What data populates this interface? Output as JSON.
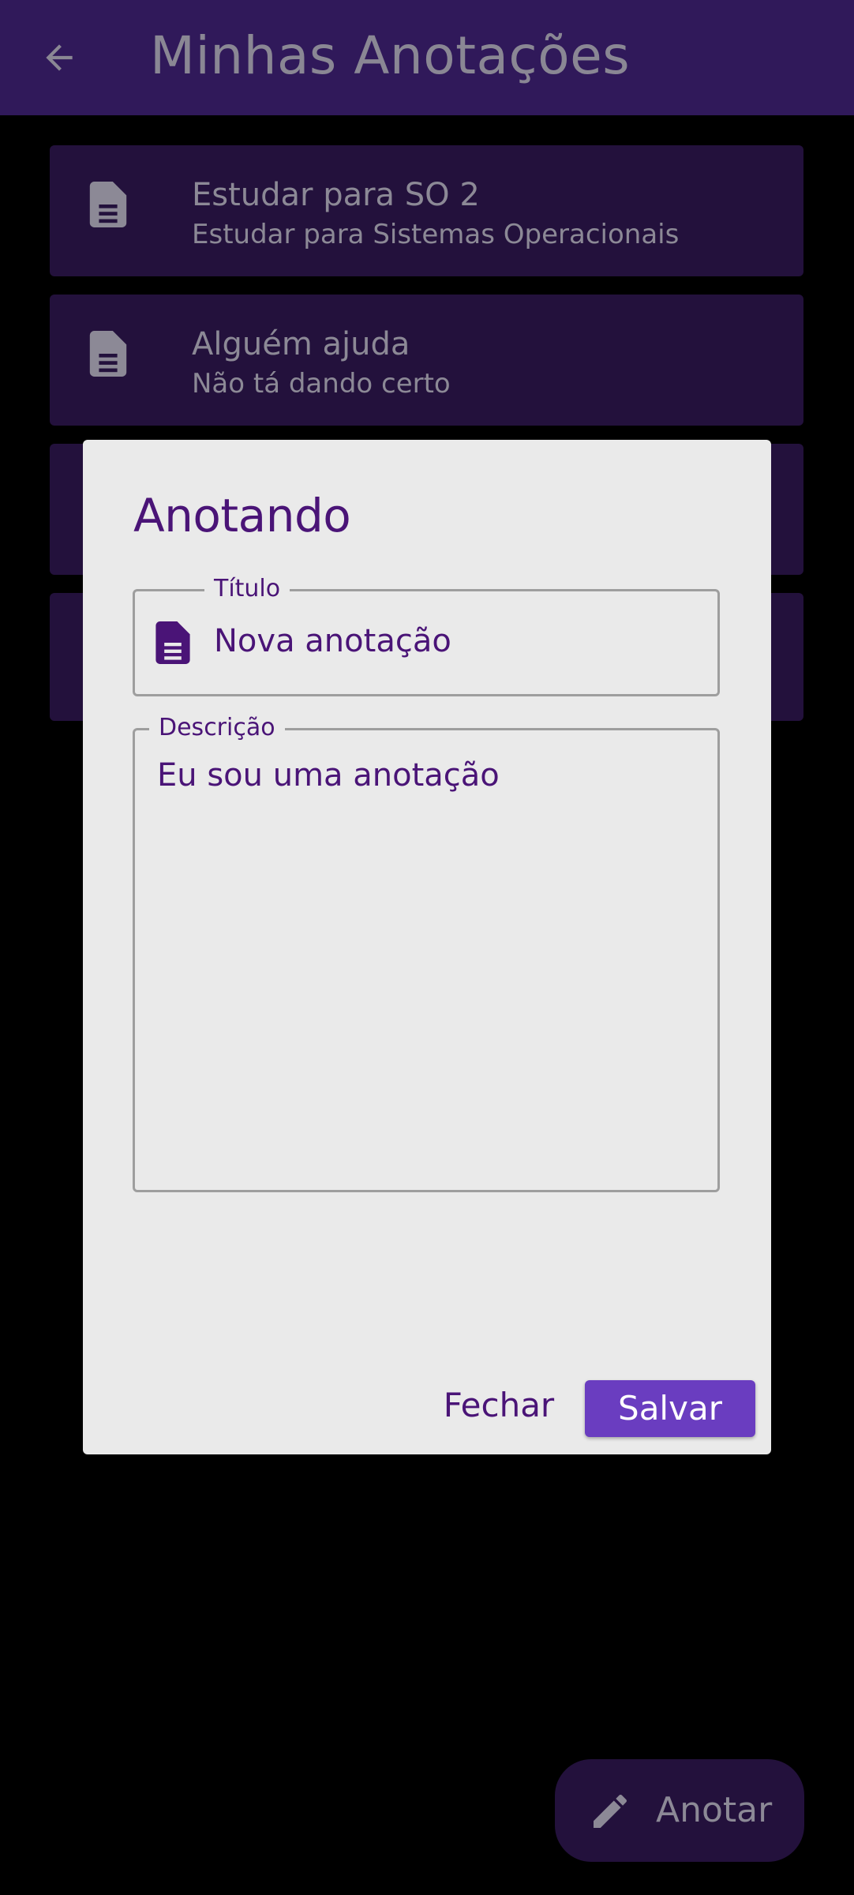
{
  "appbar": {
    "title": "Minhas Anotações",
    "back_icon": "arrow-back-icon"
  },
  "notes": [
    {
      "title": "Estudar para SO 2",
      "description": "Estudar para Sistemas Operacionais",
      "icon": "document-icon"
    },
    {
      "title": "Alguém ajuda",
      "description": "Não tá dando certo",
      "icon": "document-icon"
    },
    {
      "title": "",
      "description": "",
      "icon": "document-icon"
    },
    {
      "title": "",
      "description": "",
      "icon": "document-icon"
    }
  ],
  "dialog": {
    "title": "Anotando",
    "title_field": {
      "label": "Título",
      "value": "Nova anotação",
      "icon": "document-icon"
    },
    "description_field": {
      "label": "Descrição",
      "value": "Eu sou uma anotação"
    },
    "close_label": "Fechar",
    "save_label": "Salvar"
  },
  "fab": {
    "label": "Anotar",
    "icon": "pencil-icon"
  },
  "colors": {
    "appbar": "#30195a",
    "card": "#23113c",
    "dialog_bg": "#eaeaea",
    "accent_text": "#4a1477",
    "save_button": "#6a3dc0",
    "muted_text": "#8c8996"
  }
}
